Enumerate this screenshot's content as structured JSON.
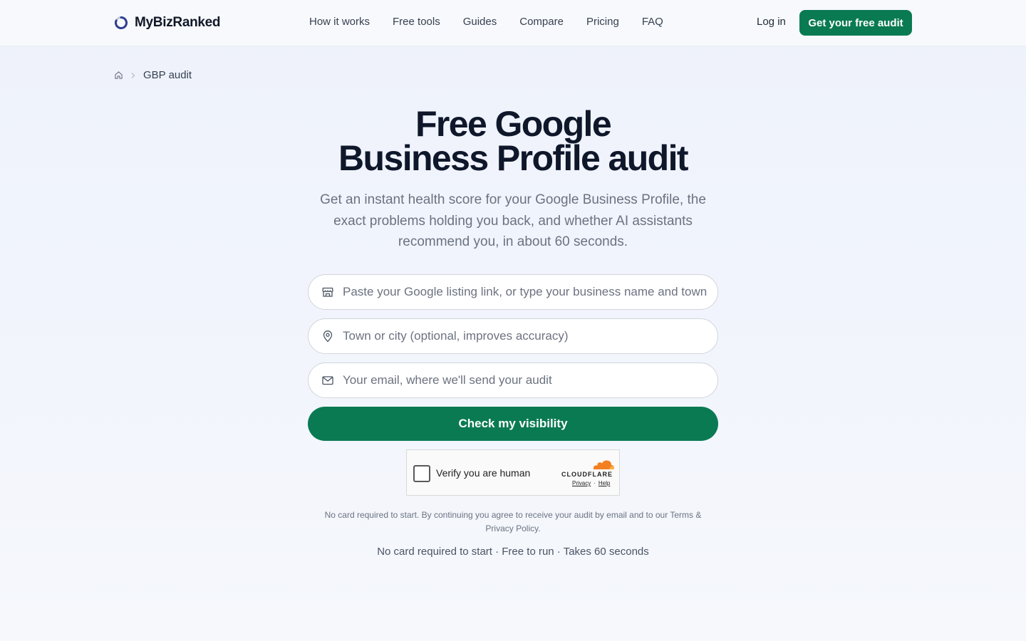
{
  "brand": {
    "name": "MyBizRanked",
    "logo_icon": "ring-logo-icon",
    "accent": "#3b4fa8"
  },
  "nav": {
    "items": [
      "How it works",
      "Free tools",
      "Guides",
      "Compare",
      "Pricing",
      "FAQ"
    ],
    "login_label": "Log in",
    "cta_label": "Get your free audit"
  },
  "breadcrumb": {
    "home_icon": "home-icon",
    "current": "GBP audit"
  },
  "hero": {
    "title_line1": "Free Google",
    "title_line2": "Business Profile audit",
    "subtitle": "Get an instant health score for your Google Business Profile, the exact problems holding you back, and whether AI assistants recommend you, in about 60 seconds."
  },
  "form": {
    "listing": {
      "icon": "storefront-icon",
      "placeholder": "Paste your Google listing link, or type your business name and town",
      "value": ""
    },
    "town": {
      "icon": "map-pin-icon",
      "placeholder": "Town or city (optional, improves accuracy)",
      "value": ""
    },
    "email": {
      "icon": "mail-icon",
      "placeholder": "Your email, where we'll send your audit",
      "value": ""
    },
    "submit_label": "Check my visibility"
  },
  "captcha": {
    "label": "Verify you are human",
    "provider": "CLOUDFLARE",
    "privacy_label": "Privacy",
    "separator": "·",
    "help_label": "Help",
    "checked": false
  },
  "legal": {
    "text": "No card required to start. By continuing you agree to receive your audit by email and to our",
    "terms_label": "Terms",
    "amp": "&",
    "privacy_label": "Privacy Policy",
    "end": "."
  },
  "tagline": "No card required to start · Free to run · Takes 60 seconds",
  "colors": {
    "primary": "#0a7a53",
    "heading": "#0f172a",
    "muted": "#6b7280",
    "cloudflare_orange": "#f38020"
  }
}
